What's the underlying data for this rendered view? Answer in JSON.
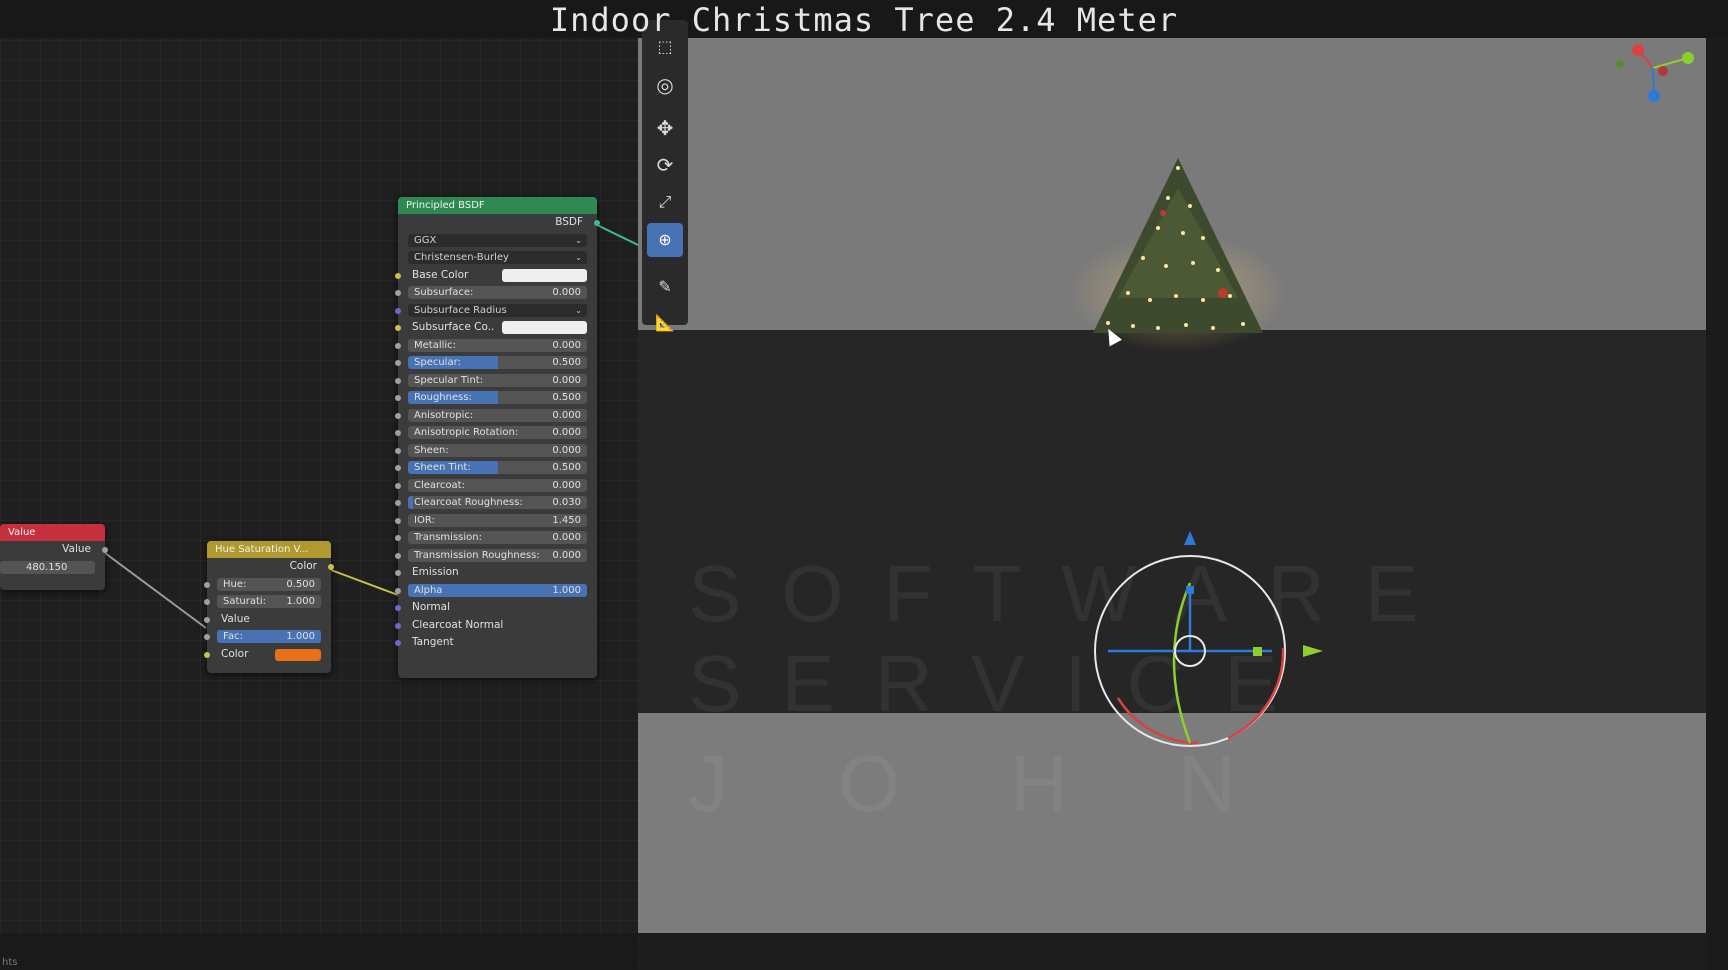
{
  "title": "Indoor Christmas Tree 2.4 Meter",
  "status_text": "hts",
  "value_node": {
    "title": "Value",
    "output": "Value",
    "field": "480.150"
  },
  "hue_node": {
    "title": "Hue Saturation V...",
    "output": "Color",
    "hue_label": "Hue:",
    "hue_value": "0.500",
    "sat_label": "Saturati:",
    "sat_value": "1.000",
    "value_label": "Value",
    "fac_label": "Fac:",
    "fac_value": "1.000",
    "color_label": "Color"
  },
  "bsdf": {
    "title": "Principled BSDF",
    "output": "BSDF",
    "distribution": "GGX",
    "subsurface_method": "Christensen-Burley",
    "rows": [
      {
        "label": "Base Color",
        "kind": "color"
      },
      {
        "label": "Subsurface:",
        "value": "0.000"
      },
      {
        "label": "Subsurface Radius",
        "kind": "dropdown"
      },
      {
        "label": "Subsurface Co..",
        "kind": "color"
      },
      {
        "label": "Metallic:",
        "value": "0.000"
      },
      {
        "label": "Specular:",
        "value": "0.500",
        "fill": 0.5
      },
      {
        "label": "Specular Tint:",
        "value": "0.000"
      },
      {
        "label": "Roughness:",
        "value": "0.500",
        "fill": 0.5
      },
      {
        "label": "Anisotropic:",
        "value": "0.000"
      },
      {
        "label": "Anisotropic Rotation:",
        "value": "0.000"
      },
      {
        "label": "Sheen:",
        "value": "0.000"
      },
      {
        "label": "Sheen Tint:",
        "value": "0.500",
        "fill": 0.5
      },
      {
        "label": "Clearcoat:",
        "value": "0.000"
      },
      {
        "label": "Clearcoat Roughness:",
        "value": "0.030",
        "fill": 0.03
      },
      {
        "label": "IOR:",
        "value": "1.450"
      },
      {
        "label": "Transmission:",
        "value": "0.000"
      },
      {
        "label": "Transmission Roughness:",
        "value": "0.000"
      },
      {
        "label": "Emission",
        "kind": "plain"
      },
      {
        "label": "Alpha",
        "value": "1.000",
        "fill": 1.0
      },
      {
        "label": "Normal",
        "kind": "plain"
      },
      {
        "label": "Clearcoat Normal",
        "kind": "plain"
      },
      {
        "label": "Tangent",
        "kind": "plain"
      }
    ]
  },
  "watermark": {
    "line1": "SOFTWARE",
    "line2": "SERVICE",
    "line3": "JOHN"
  },
  "tools": [
    "select-box-tool",
    "cursor-tool",
    "move-tool",
    "rotate-tool",
    "scale-tool",
    "transform-tool",
    "annotate-tool",
    "measure-tool"
  ],
  "colors": {
    "value_header": "#c6303c",
    "hue_header": "#b09a30",
    "bsdf_header": "#2f8a52",
    "accent": "#4772b3",
    "hue_color": "#e8701a"
  }
}
